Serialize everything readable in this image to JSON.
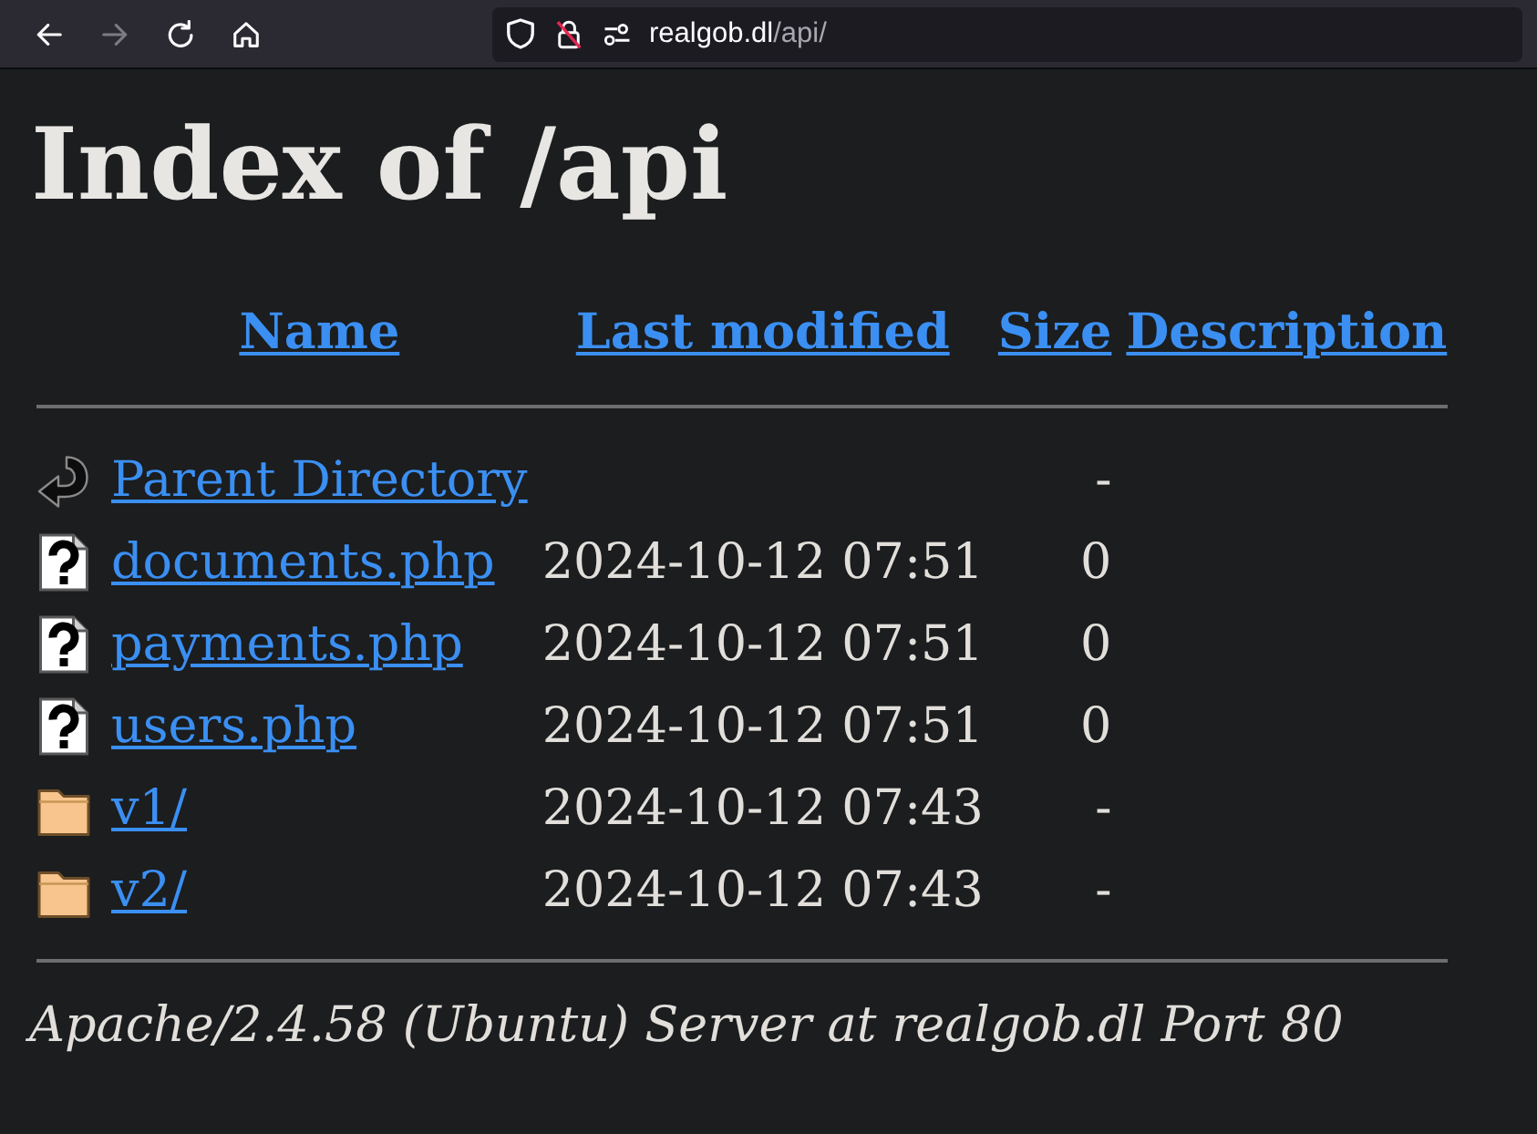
{
  "browser": {
    "nav_buttons": [
      {
        "kind": "back",
        "disabled": false
      },
      {
        "kind": "forward",
        "disabled": true
      },
      {
        "kind": "reload",
        "disabled": false
      },
      {
        "kind": "home",
        "disabled": false
      }
    ],
    "connection_secure": false,
    "url": {
      "host": "realgob.dl",
      "path": "/api/"
    }
  },
  "page": {
    "title": "Index of /api",
    "columns": [
      "Name",
      "Last modified",
      "Size",
      "Description"
    ],
    "rows": [
      {
        "kind": "parent",
        "name": "Parent Directory",
        "size": "-"
      },
      {
        "kind": "file",
        "name": "documents.php",
        "modified": "2024-10-12 07:51",
        "size": "0"
      },
      {
        "kind": "file",
        "name": "payments.php",
        "modified": "2024-10-12 07:51",
        "size": "0"
      },
      {
        "kind": "file",
        "name": "users.php",
        "modified": "2024-10-12 07:51",
        "size": "0"
      },
      {
        "kind": "folder",
        "name": "v1/",
        "modified": "2024-10-12 07:43",
        "size": "-"
      },
      {
        "kind": "folder",
        "name": "v2/",
        "modified": "2024-10-12 07:43",
        "size": "-"
      }
    ],
    "footer": "Apache/2.4.58 (Ubuntu) Server at realgob.dl Port 80"
  }
}
